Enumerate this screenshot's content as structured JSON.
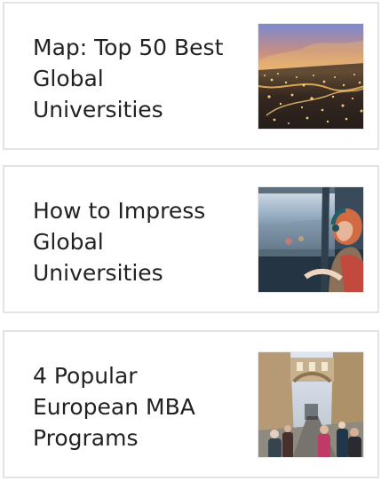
{
  "cards": [
    {
      "title": "Map: Top 50 Best Global Universities",
      "image_icon": "night-city-aerial-image"
    },
    {
      "title": "How to Impress Global Universities",
      "image_icon": "student-on-train-window-image"
    },
    {
      "title": "4 Popular European MBA Programs",
      "image_icon": "historic-street-bridge-image"
    }
  ]
}
